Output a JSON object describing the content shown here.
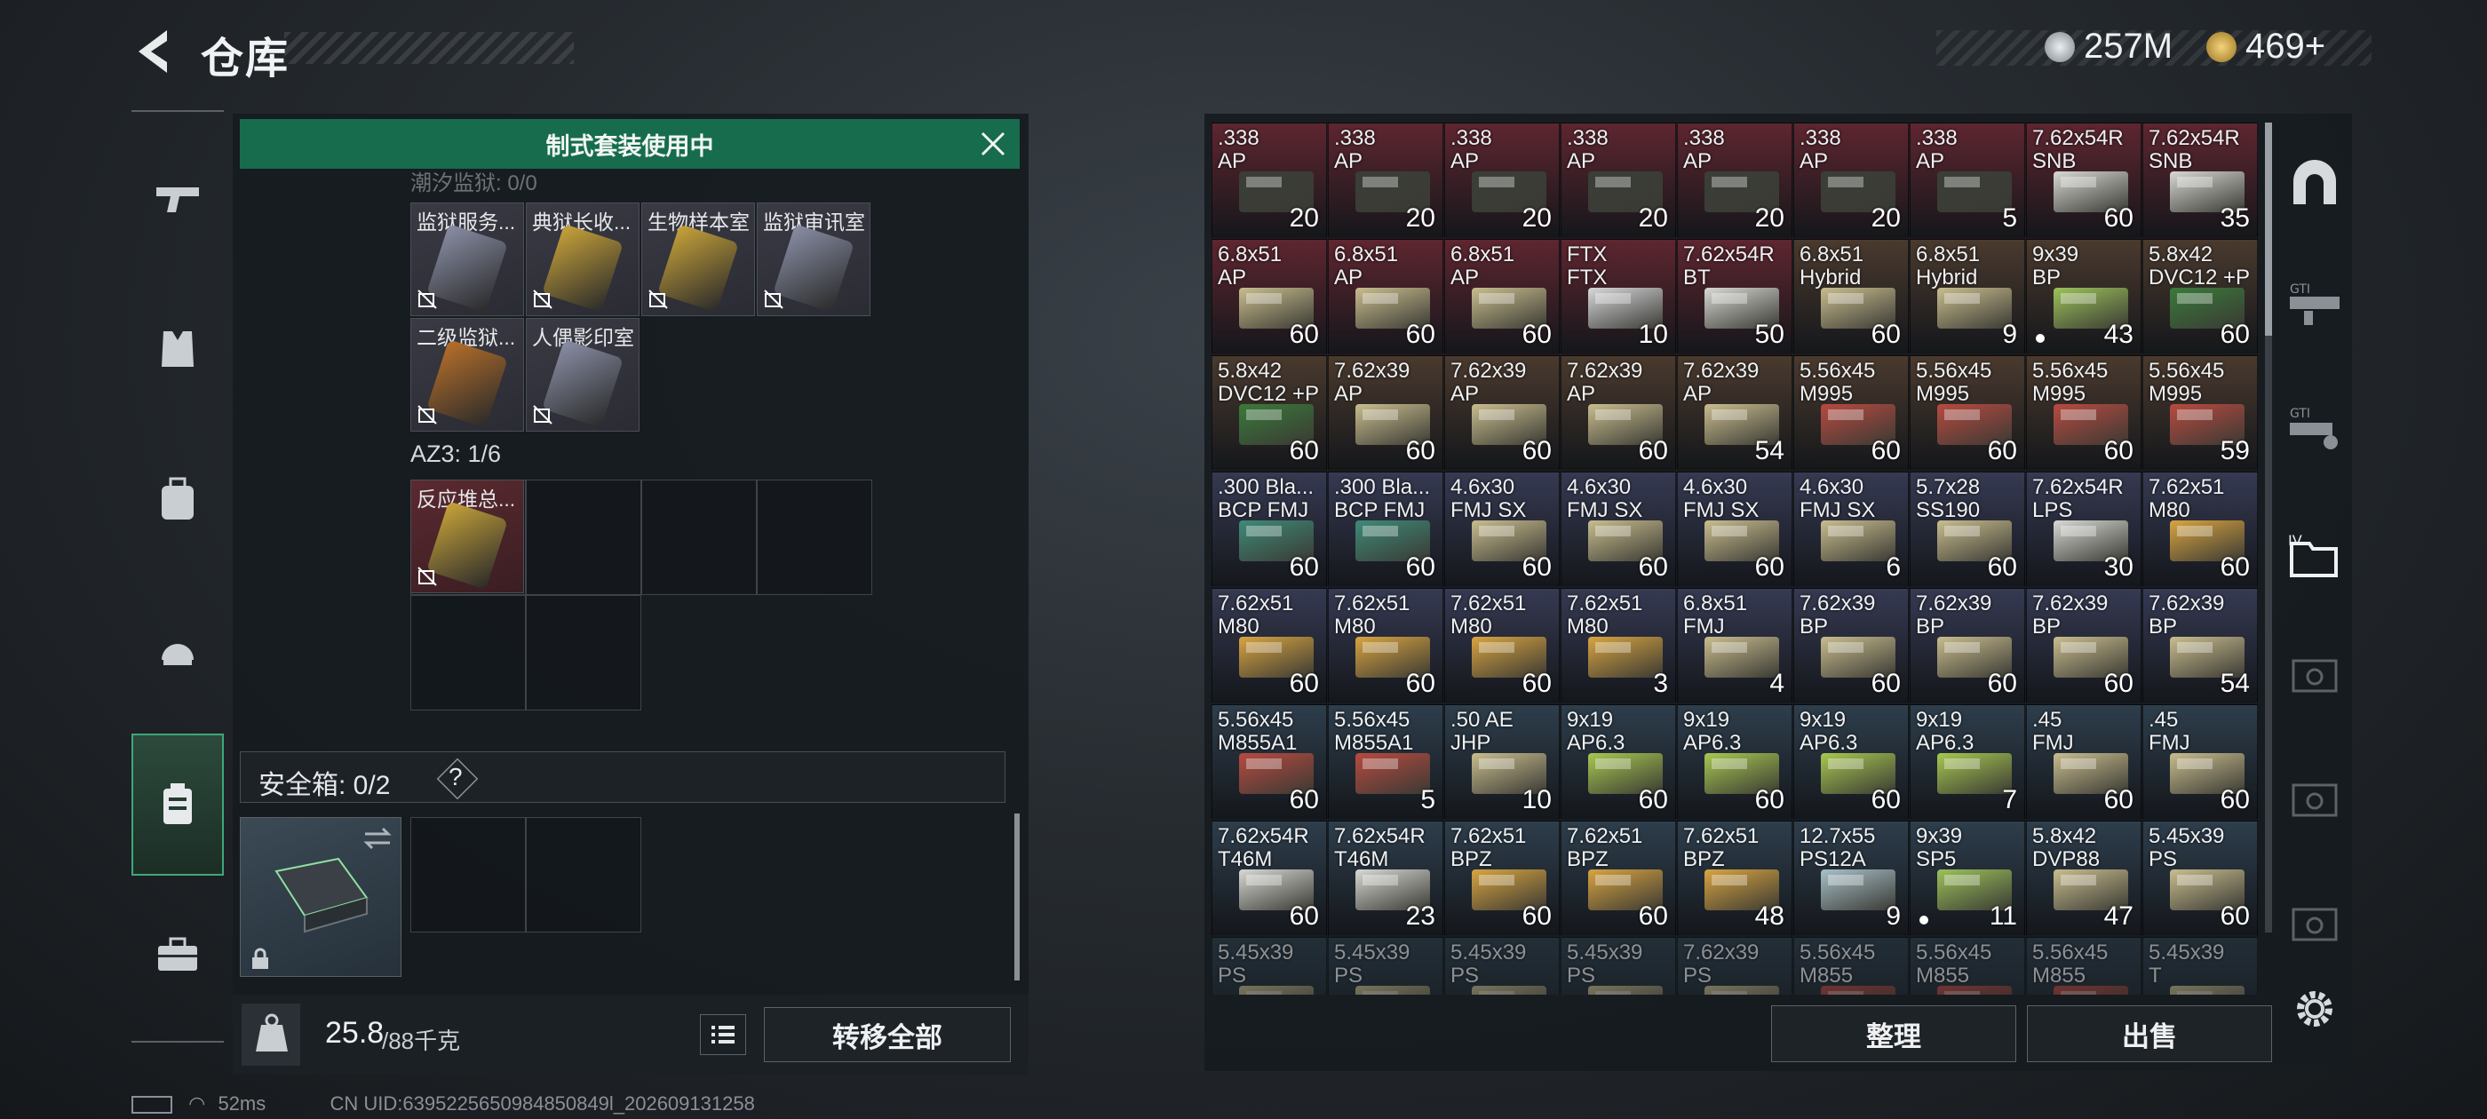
{
  "header": {
    "title": "仓库"
  },
  "currency": [
    {
      "name": "silver-coin-icon",
      "value": "257M",
      "color": "#c8ccd0"
    },
    {
      "name": "gold-coin-icon",
      "value": "469+",
      "color": "#d4a94a"
    }
  ],
  "banner": {
    "text": "制式套装使用中"
  },
  "left": {
    "section_fade": "潮汐监狱: 0/0",
    "keys": [
      {
        "label": "监狱服务...",
        "color": "#8a8fa6"
      },
      {
        "label": "典狱长收...",
        "color": "#c9a43a"
      },
      {
        "label": "生物样本室",
        "color": "#c9a43a"
      },
      {
        "label": "监狱审讯室",
        "color": "#8a8fa6"
      },
      {
        "label": "二级监狱...",
        "color": "#b8702a"
      },
      {
        "label": "人偶影印室",
        "color": "#8a8fa6"
      }
    ],
    "az3_label": "AZ3: 1/6",
    "az3_items": [
      {
        "label": "反应堆总...",
        "color": "#c9a43a"
      }
    ],
    "safebox_label": "安全箱: 0/2",
    "help": "?"
  },
  "bottom": {
    "weight_value": "25.8",
    "weight_total": "/88千克",
    "transfer_all": "转移全部"
  },
  "right_buttons": {
    "organize": "整理",
    "sell": "出售"
  },
  "status": {
    "ping": "52ms",
    "uid": "CN UID:6395225650984850849l_202609131258"
  },
  "grid": [
    [
      {
        "t": ".338\nAP",
        "q": "20",
        "bg": "#5e2630",
        "box": "#3a3f36"
      },
      {
        "t": ".338\nAP",
        "q": "20",
        "bg": "#5e2630",
        "box": "#3a3f36"
      },
      {
        "t": ".338\nAP",
        "q": "20",
        "bg": "#5e2630",
        "box": "#3a3f36"
      },
      {
        "t": ".338\nAP",
        "q": "20",
        "bg": "#5e2630",
        "box": "#3a3f36"
      },
      {
        "t": ".338\nAP",
        "q": "20",
        "bg": "#5e2630",
        "box": "#3a3f36"
      },
      {
        "t": ".338\nAP",
        "q": "20",
        "bg": "#5e2630",
        "box": "#3a3f36"
      },
      {
        "t": ".338\nAP",
        "q": "5",
        "bg": "#5e2630",
        "box": "#3a3f36"
      },
      {
        "t": "7.62x54R\nSNB",
        "q": "60",
        "bg": "#5e2630",
        "box": "#d8d8d4"
      },
      {
        "t": "7.62x54R\nSNB",
        "q": "35",
        "bg": "#5e2630",
        "box": "#d8d8d4"
      }
    ],
    [
      {
        "t": "6.8x51\nAP",
        "q": "60",
        "bg": "#5e2630",
        "box": "#c9bd8e"
      },
      {
        "t": "6.8x51\nAP",
        "q": "60",
        "bg": "#5e2630",
        "box": "#c9bd8e"
      },
      {
        "t": "6.8x51\nAP",
        "q": "60",
        "bg": "#5e2630",
        "box": "#c9bd8e"
      },
      {
        "t": "FTX\nFTX",
        "q": "10",
        "bg": "#5e2630",
        "box": "#d8d8dc"
      },
      {
        "t": "7.62x54R\nBT",
        "q": "50",
        "bg": "#5e2630",
        "box": "#d8d8d4"
      },
      {
        "t": "6.8x51\nHybrid",
        "q": "60",
        "bg": "#4a3a2e",
        "box": "#c9bd8e"
      },
      {
        "t": "6.8x51\nHybrid",
        "q": "9",
        "bg": "#4a3a2e",
        "box": "#c9bd8e"
      },
      {
        "t": "9x39\nBP",
        "q": "43",
        "bg": "#4a3a2e",
        "box": "#9cc25a",
        "dot": true
      },
      {
        "t": "5.8x42\nDVC12 +P",
        "q": "60",
        "bg": "#4a3a2e",
        "box": "#3a7a3a"
      }
    ],
    [
      {
        "t": "5.8x42\nDVC12 +P",
        "q": "60",
        "bg": "#4a3a2e",
        "box": "#3a7a3a"
      },
      {
        "t": "7.62x39\nAP",
        "q": "60",
        "bg": "#4a3a2e",
        "box": "#c9bd8e"
      },
      {
        "t": "7.62x39\nAP",
        "q": "60",
        "bg": "#4a3a2e",
        "box": "#c9bd8e"
      },
      {
        "t": "7.62x39\nAP",
        "q": "60",
        "bg": "#4a3a2e",
        "box": "#c9bd8e"
      },
      {
        "t": "7.62x39\nAP",
        "q": "54",
        "bg": "#4a3a2e",
        "box": "#c9bd8e"
      },
      {
        "t": "5.56x45\nM995",
        "q": "60",
        "bg": "#4a3a2e",
        "box": "#b84a40"
      },
      {
        "t": "5.56x45\nM995",
        "q": "60",
        "bg": "#4a3a2e",
        "box": "#b84a40"
      },
      {
        "t": "5.56x45\nM995",
        "q": "60",
        "bg": "#4a3a2e",
        "box": "#b84a40"
      },
      {
        "t": "5.56x45\nM995",
        "q": "59",
        "bg": "#4a3a2e",
        "box": "#b84a40"
      }
    ],
    [
      {
        "t": ".300 Bla...\nBCP FMJ",
        "q": "60",
        "bg": "#363a52",
        "box": "#3e8a78"
      },
      {
        "t": ".300 Bla...\nBCP FMJ",
        "q": "60",
        "bg": "#363a52",
        "box": "#3e8a78"
      },
      {
        "t": "4.6x30\nFMJ SX",
        "q": "60",
        "bg": "#363a52",
        "box": "#c9bd8e"
      },
      {
        "t": "4.6x30\nFMJ SX",
        "q": "60",
        "bg": "#363a52",
        "box": "#c9bd8e"
      },
      {
        "t": "4.6x30\nFMJ SX",
        "q": "60",
        "bg": "#363a52",
        "box": "#c9bd8e"
      },
      {
        "t": "4.6x30\nFMJ SX",
        "q": "6",
        "bg": "#363a52",
        "box": "#c9bd8e"
      },
      {
        "t": "5.7x28\nSS190",
        "q": "60",
        "bg": "#363a52",
        "box": "#c9bd8e"
      },
      {
        "t": "7.62x54R\nLPS",
        "q": "30",
        "bg": "#363a52",
        "box": "#d8d8d4"
      },
      {
        "t": "7.62x51\nM80",
        "q": "60",
        "bg": "#363a52",
        "box": "#d9a440"
      }
    ],
    [
      {
        "t": "7.62x51\nM80",
        "q": "60",
        "bg": "#363a52",
        "box": "#d9a440"
      },
      {
        "t": "7.62x51\nM80",
        "q": "60",
        "bg": "#363a52",
        "box": "#d9a440"
      },
      {
        "t": "7.62x51\nM80",
        "q": "60",
        "bg": "#363a52",
        "box": "#d9a440"
      },
      {
        "t": "7.62x51\nM80",
        "q": "3",
        "bg": "#363a52",
        "box": "#d9a440"
      },
      {
        "t": "6.8x51\nFMJ",
        "q": "4",
        "bg": "#363a52",
        "box": "#c9bd8e"
      },
      {
        "t": "7.62x39\nBP",
        "q": "60",
        "bg": "#363a52",
        "box": "#c9bd8e"
      },
      {
        "t": "7.62x39\nBP",
        "q": "60",
        "bg": "#363a52",
        "box": "#c9bd8e"
      },
      {
        "t": "7.62x39\nBP",
        "q": "60",
        "bg": "#363a52",
        "box": "#c9bd8e"
      },
      {
        "t": "7.62x39\nBP",
        "q": "54",
        "bg": "#363a52",
        "box": "#c9bd8e"
      }
    ],
    [
      {
        "t": "5.56x45\nM855A1",
        "q": "60",
        "bg": "#2e3e4c",
        "box": "#b84a40"
      },
      {
        "t": "5.56x45\nM855A1",
        "q": "5",
        "bg": "#2e3e4c",
        "box": "#b84a40"
      },
      {
        "t": ".50 AE\nJHP",
        "q": "10",
        "bg": "#2e3e4c",
        "box": "#c9bd8e"
      },
      {
        "t": "9x19\nAP6.3",
        "q": "60",
        "bg": "#2e3e4c",
        "box": "#a8c850"
      },
      {
        "t": "9x19\nAP6.3",
        "q": "60",
        "bg": "#2e3e4c",
        "box": "#a8c850"
      },
      {
        "t": "9x19\nAP6.3",
        "q": "60",
        "bg": "#2e3e4c",
        "box": "#a8c850"
      },
      {
        "t": "9x19\nAP6.3",
        "q": "7",
        "bg": "#2e3e4c",
        "box": "#a8c850"
      },
      {
        "t": ".45\nFMJ",
        "q": "60",
        "bg": "#2e3e4c",
        "box": "#c9bd8e"
      },
      {
        "t": ".45\nFMJ",
        "q": "60",
        "bg": "#2e3e4c",
        "box": "#c9bd8e"
      }
    ],
    [
      {
        "t": "7.62x54R\nT46M",
        "q": "60",
        "bg": "#2e3e4c",
        "box": "#d8d8d4"
      },
      {
        "t": "7.62x54R\nT46M",
        "q": "23",
        "bg": "#2e3e4c",
        "box": "#d8d8d4"
      },
      {
        "t": "7.62x51\nBPZ",
        "q": "60",
        "bg": "#2e3e4c",
        "box": "#d9a440"
      },
      {
        "t": "7.62x51\nBPZ",
        "q": "60",
        "bg": "#2e3e4c",
        "box": "#d9a440"
      },
      {
        "t": "7.62x51\nBPZ",
        "q": "48",
        "bg": "#2e3e4c",
        "box": "#d9a440"
      },
      {
        "t": "12.7x55\nPS12A",
        "q": "9",
        "bg": "#2e3e4c",
        "box": "#a8c0c8"
      },
      {
        "t": "9x39\nSP5",
        "q": "11",
        "bg": "#2e3e4c",
        "box": "#9cc25a",
        "dot": true
      },
      {
        "t": "5.8x42\nDVP88",
        "q": "47",
        "bg": "#2e3e4c",
        "box": "#c9bd8e"
      },
      {
        "t": "5.45x39\nPS",
        "q": "60",
        "bg": "#2e3e4c",
        "box": "#c9bd8e"
      }
    ],
    [
      {
        "t": "5.45x39\nPS",
        "q": "",
        "bg": "#2e3e4c",
        "box": "#c9bd8e"
      },
      {
        "t": "5.45x39\nPS",
        "q": "",
        "bg": "#2e3e4c",
        "box": "#c9bd8e"
      },
      {
        "t": "5.45x39\nPS",
        "q": "",
        "bg": "#2e3e4c",
        "box": "#c9bd8e"
      },
      {
        "t": "5.45x39\nPS",
        "q": "",
        "bg": "#2e3e4c",
        "box": "#c9bd8e"
      },
      {
        "t": "7.62x39\nPS",
        "q": "",
        "bg": "#2e3e4c",
        "box": "#c9bd8e"
      },
      {
        "t": "5.56x45\nM855",
        "q": "",
        "bg": "#2e3e4c",
        "box": "#b84a40"
      },
      {
        "t": "5.56x45\nM855",
        "q": "",
        "bg": "#2e3e4c",
        "box": "#b84a40"
      },
      {
        "t": "5.56x45\nM855",
        "q": "",
        "bg": "#2e3e4c",
        "box": "#b84a40"
      },
      {
        "t": "5.45x39\nT",
        "q": "",
        "bg": "#2e3e4c",
        "box": "#c9bd8e"
      }
    ]
  ]
}
